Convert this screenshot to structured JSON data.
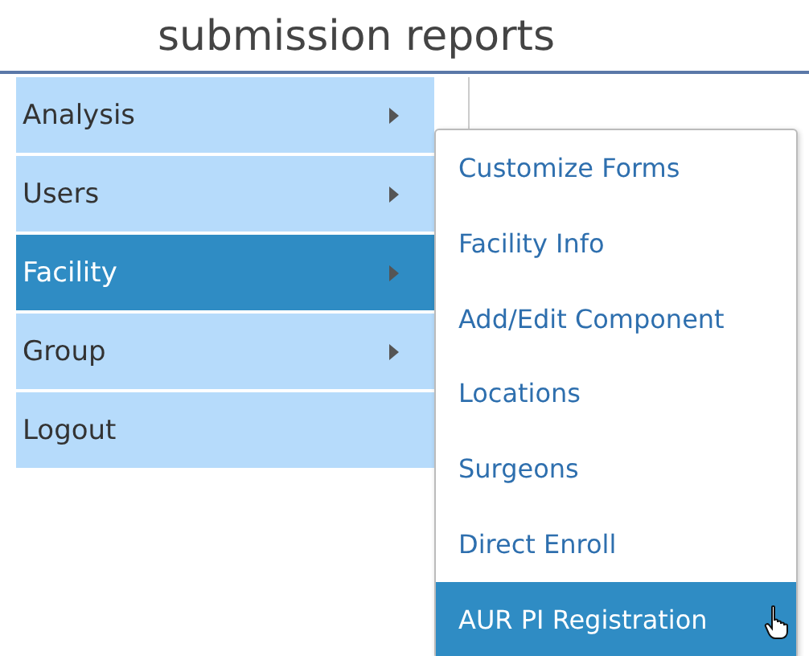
{
  "page_title": "submission reports",
  "menu": [
    {
      "label": "Analysis",
      "has_submenu": true,
      "selected": false
    },
    {
      "label": "Users",
      "has_submenu": true,
      "selected": false
    },
    {
      "label": "Facility",
      "has_submenu": true,
      "selected": true
    },
    {
      "label": "Group",
      "has_submenu": true,
      "selected": false
    },
    {
      "label": "Logout",
      "has_submenu": false,
      "selected": false
    }
  ],
  "submenu": [
    {
      "label": "Customize Forms",
      "selected": false
    },
    {
      "label": "Facility Info",
      "selected": false
    },
    {
      "label": "Add/Edit Component",
      "selected": false
    },
    {
      "label": "Locations",
      "selected": false
    },
    {
      "label": "Surgeons",
      "selected": false
    },
    {
      "label": "Direct Enroll",
      "selected": false
    },
    {
      "label": "AUR PI Registration",
      "selected": true
    }
  ]
}
